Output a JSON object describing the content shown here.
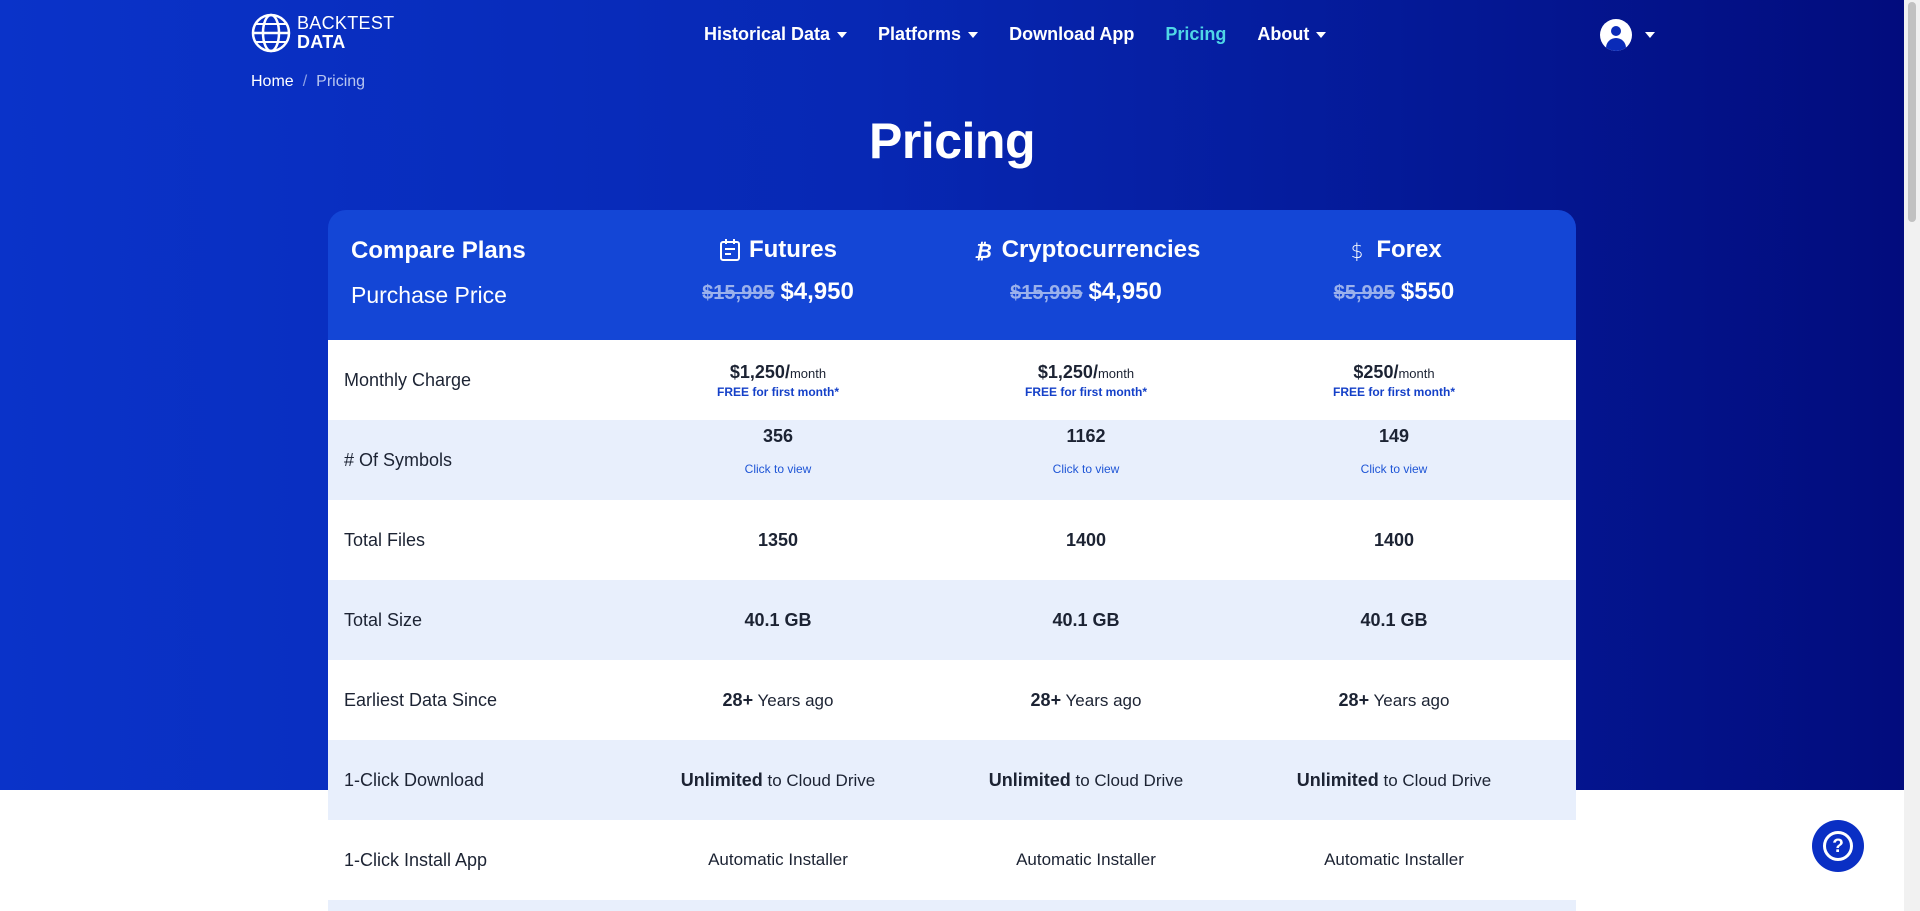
{
  "brand": {
    "line1": "BACKTEST",
    "line2": "DATA"
  },
  "nav": {
    "items": [
      {
        "label": "Historical Data",
        "dropdown": true,
        "active": false
      },
      {
        "label": "Platforms",
        "dropdown": true,
        "active": false
      },
      {
        "label": "Download App",
        "dropdown": false,
        "active": false
      },
      {
        "label": "Pricing",
        "dropdown": false,
        "active": true
      },
      {
        "label": "About",
        "dropdown": true,
        "active": false
      }
    ]
  },
  "breadcrumb": {
    "home": "Home",
    "separator": "/",
    "current": "Pricing"
  },
  "page_title": "Pricing",
  "table": {
    "compare_label": "Compare Plans",
    "purchase_label": "Purchase Price",
    "plans": [
      {
        "icon": "calendar-icon",
        "name": "Futures",
        "old_price": "$15,995",
        "price": "$4,950"
      },
      {
        "icon": "bitcoin-icon",
        "name": "Cryptocurrencies",
        "old_price": "$15,995",
        "price": "$4,950"
      },
      {
        "icon": "dollar-icon",
        "name": "Forex",
        "old_price": "$5,995",
        "price": "$550"
      }
    ],
    "rows": {
      "monthly": {
        "label": "Monthly Charge",
        "unit": "month",
        "free_note": "FREE for first month*",
        "values": [
          "$1,250/",
          "$1,250/",
          "$250/"
        ]
      },
      "symbols": {
        "label": "# Of Symbols",
        "link": "Click to view",
        "values": [
          "356",
          "1162",
          "149"
        ]
      },
      "files": {
        "label": "Total Files",
        "values": [
          "1350",
          "1400",
          "1400"
        ]
      },
      "size": {
        "label": "Total Size",
        "values": [
          "40.1 GB",
          "40.1 GB",
          "40.1 GB"
        ]
      },
      "earliest": {
        "label": "Earliest Data Since",
        "bold": "28+",
        "text": " Years ago"
      },
      "download": {
        "label": "1-Click Download",
        "bold": "Unlimited",
        "text": " to Cloud Drive"
      },
      "install": {
        "label": "1-Click Install App",
        "values": [
          "Automatic Installer",
          "Automatic Installer",
          "Automatic Installer"
        ]
      }
    }
  },
  "help_button": "?",
  "colors": {
    "hero_start": "#0a33c9",
    "hero_end": "#020c7d",
    "active_nav": "#4fd6e6",
    "table_header": "#1446d6",
    "stripe": "#e8effc"
  }
}
